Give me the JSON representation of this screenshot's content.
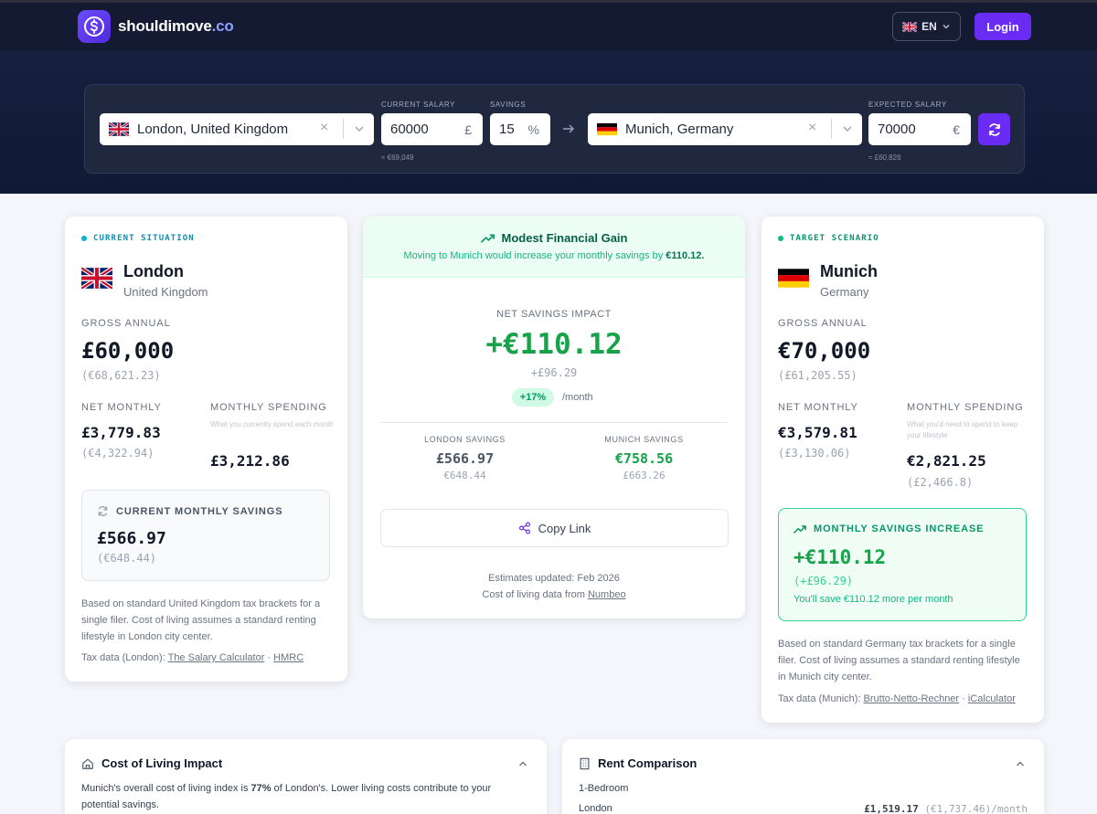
{
  "header": {
    "logo_main": "shouldimove",
    "logo_tld": ".co",
    "language": "EN",
    "login_label": "Login"
  },
  "search": {
    "origin_city": "London, United Kingdom",
    "current_salary_label": "CURRENT SALARY",
    "current_salary": "60000",
    "current_salary_unit": "£",
    "current_salary_hint": "≈ €69,049",
    "savings_label": "SAVINGS",
    "savings": "15",
    "savings_unit": "%",
    "target_city": "Munich, Germany",
    "expected_salary_label": "EXPECTED SALARY",
    "expected_salary": "70000",
    "expected_salary_unit": "€",
    "expected_salary_hint": "≈ £60,826"
  },
  "current": {
    "tag": "CURRENT SITUATION",
    "city": "London",
    "country": "United Kingdom",
    "gross_label": "GROSS ANNUAL",
    "gross": "£60,000",
    "gross_alt": "(€68,621.23)",
    "net_label": "NET MONTHLY",
    "net": "£3,779.83",
    "net_alt": "(€4,322.94)",
    "spend_label": "MONTHLY SPENDING",
    "spend_hint": "What you currently spend each month",
    "spend": "£3,212.86",
    "savings_label": "CURRENT MONTHLY SAVINGS",
    "savings": "£566.97",
    "savings_alt": "(€648.44)",
    "note": "Based on standard United Kingdom tax brackets for a single filer. Cost of living assumes a standard renting lifestyle in London city center.",
    "tax_prefix": "Tax data (London):",
    "tax_link1": "The Salary Calculator",
    "tax_sep": "·",
    "tax_link2": "HMRC"
  },
  "impact": {
    "headline": "Modest Financial Gain",
    "message_pre": "Moving to Munich would increase your monthly savings by",
    "message_amount": "€110.12.",
    "net_label": "NET SAVINGS IMPACT",
    "net_value": "+€110.12",
    "net_alt": "+£96.29",
    "percent": "+17%",
    "per": "/month",
    "london_label": "LONDON SAVINGS",
    "london_value": "£566.97",
    "london_alt": "€648.44",
    "munich_label": "MUNICH SAVINGS",
    "munich_value": "€758.56",
    "munich_alt": "£663.26",
    "copy_label": "Copy Link",
    "updated": "Estimates updated: Feb 2026",
    "source_prefix": "Cost of living data from",
    "source_link": "Numbeo"
  },
  "target": {
    "tag": "TARGET SCENARIO",
    "city": "Munich",
    "country": "Germany",
    "gross_label": "GROSS ANNUAL",
    "gross": "€70,000",
    "gross_alt": "(£61,205.55)",
    "net_label": "NET MONTHLY",
    "net": "€3,579.81",
    "net_alt": "(£3,130.06)",
    "spend_label": "MONTHLY SPENDING",
    "spend_hint": "What you'd need to spend to keep your lifestyle",
    "spend": "€2,821.25",
    "spend_alt": "(£2,466.8)",
    "increase_label": "MONTHLY SAVINGS INCREASE",
    "increase": "+€110.12",
    "increase_alt": "(+£96.29)",
    "increase_note": "You'll save €110.12 more per month",
    "note": "Based on standard Germany tax brackets for a single filer. Cost of living assumes a standard renting lifestyle in Munich city center.",
    "tax_prefix": "Tax data (Munich):",
    "tax_link1": "Brutto-Netto-Rechner",
    "tax_sep": "·",
    "tax_link2": "iCalculator"
  },
  "col": {
    "title": "Cost of Living Impact",
    "text_pre": "Munich's overall cost of living index is",
    "text_pct": "77%",
    "text_post": "of London's. Lower living costs contribute to your potential savings."
  },
  "rent": {
    "title": "Rent Comparison",
    "category": "1-Bedroom",
    "row_city": "London",
    "row_value": "£1,519.17",
    "row_alt": "(€1,737.46)/month"
  },
  "colors": {
    "accent": "#6a2cf5",
    "positive": "#16a34a",
    "cyan": "#06b6d4"
  }
}
